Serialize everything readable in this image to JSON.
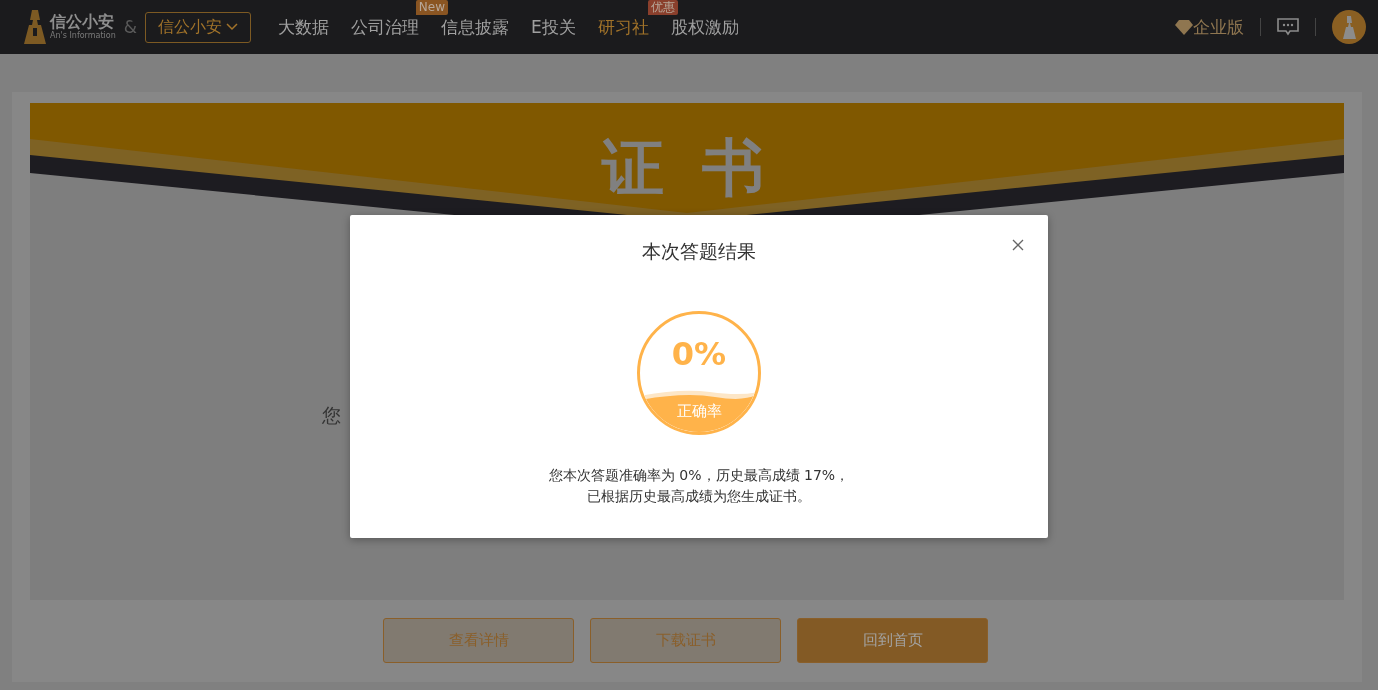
{
  "header": {
    "logo": {
      "name": "信公小安",
      "subtitle": "An's Information"
    },
    "ampersand": "&",
    "product_dropdown": "信公小安",
    "nav": [
      {
        "label": "大数据",
        "selected": false
      },
      {
        "label": "公司治理",
        "selected": false,
        "badge": "New"
      },
      {
        "label": "信息披露",
        "selected": false
      },
      {
        "label": "E投关",
        "selected": false
      },
      {
        "label": "研习社",
        "selected": true,
        "badge": "优惠"
      },
      {
        "label": "股权激励",
        "selected": false
      }
    ],
    "edition": "企业版"
  },
  "certificate": {
    "title": "证 书",
    "body_fragment": "您"
  },
  "buttons": [
    {
      "label": "查看详情",
      "kind": "outline"
    },
    {
      "label": "下载证书",
      "kind": "outline"
    },
    {
      "label": "回到首页",
      "kind": "filled"
    }
  ],
  "dialog": {
    "title": "本次答题结果",
    "score": "0%",
    "score_label": "正确率",
    "message_lines": [
      "您本次答题准确率为 0%，历史最高成绩 17%，",
      "已根据历史最高成绩为您生成证书。"
    ]
  }
}
